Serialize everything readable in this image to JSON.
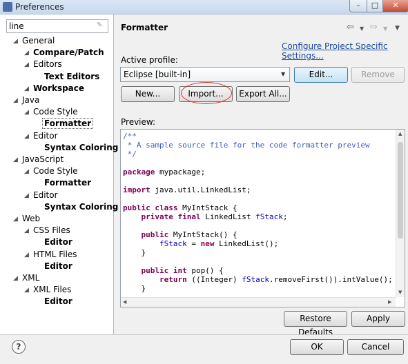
{
  "window": {
    "title": "Preferences",
    "min_glyph": "–",
    "max_glyph": "□",
    "close_glyph": "✕"
  },
  "filter": {
    "value": "line",
    "clear_icon": "eraser-icon"
  },
  "tree": [
    {
      "label": "General",
      "level": 0,
      "bold": false,
      "expanded": true
    },
    {
      "label": "Compare/Patch",
      "level": 1,
      "bold": true
    },
    {
      "label": "Editors",
      "level": 1,
      "bold": false,
      "expanded": true
    },
    {
      "label": "Text Editors",
      "level": 2,
      "bold": true
    },
    {
      "label": "Workspace",
      "level": 1,
      "bold": true
    },
    {
      "label": "Java",
      "level": 0,
      "bold": false,
      "expanded": true
    },
    {
      "label": "Code Style",
      "level": 1,
      "bold": false,
      "expanded": true
    },
    {
      "label": "Formatter",
      "level": 2,
      "bold": true,
      "selected": true
    },
    {
      "label": "Editor",
      "level": 1,
      "bold": false,
      "expanded": true
    },
    {
      "label": "Syntax Coloring",
      "level": 2,
      "bold": true
    },
    {
      "label": "JavaScript",
      "level": 0,
      "bold": false,
      "expanded": true
    },
    {
      "label": "Code Style",
      "level": 1,
      "bold": false,
      "expanded": true
    },
    {
      "label": "Formatter",
      "level": 2,
      "bold": true
    },
    {
      "label": "Editor",
      "level": 1,
      "bold": false,
      "expanded": true
    },
    {
      "label": "Syntax Coloring",
      "level": 2,
      "bold": true
    },
    {
      "label": "Web",
      "level": 0,
      "bold": false,
      "expanded": true
    },
    {
      "label": "CSS Files",
      "level": 1,
      "bold": false,
      "expanded": true
    },
    {
      "label": "Editor",
      "level": 2,
      "bold": true
    },
    {
      "label": "HTML Files",
      "level": 1,
      "bold": false,
      "expanded": true
    },
    {
      "label": "Editor",
      "level": 2,
      "bold": true
    },
    {
      "label": "XML",
      "level": 0,
      "bold": false,
      "expanded": true
    },
    {
      "label": "XML Files",
      "level": 1,
      "bold": false,
      "expanded": true
    },
    {
      "label": "Editor",
      "level": 2,
      "bold": true
    }
  ],
  "page": {
    "title": "Formatter",
    "configure_link": "Configure Project Specific Settings...",
    "active_profile_label": "Active profile:",
    "active_profile_value": "Eclipse [built-in]",
    "edit_label": "Edit...",
    "remove_label": "Remove",
    "new_label": "New...",
    "import_label": "Import...",
    "export_label": "Export All...",
    "preview_label": "Preview:",
    "restore_defaults_label": "Restore Defaults",
    "apply_label": "Apply",
    "ok_label": "OK",
    "cancel_label": "Cancel",
    "help_glyph": "?"
  },
  "preview_code": [
    [
      {
        "t": "/**",
        "c": "comment"
      }
    ],
    [
      {
        "t": " * A sample source file for the code formatter preview",
        "c": "comment"
      }
    ],
    [
      {
        "t": " */",
        "c": "comment"
      }
    ],
    [],
    [
      {
        "t": "package",
        "c": "kw"
      },
      {
        "t": " mypackage;"
      }
    ],
    [],
    [
      {
        "t": "import",
        "c": "kw"
      },
      {
        "t": " java.util.LinkedList;"
      }
    ],
    [],
    [
      {
        "t": "public",
        "c": "kw"
      },
      {
        "t": " "
      },
      {
        "t": "class",
        "c": "kw"
      },
      {
        "t": " MyIntStack {"
      }
    ],
    [
      {
        "t": "    "
      },
      {
        "t": "private",
        "c": "kw"
      },
      {
        "t": " "
      },
      {
        "t": "final",
        "c": "kw"
      },
      {
        "t": " LinkedList "
      },
      {
        "t": "fStack",
        "c": "fld"
      },
      {
        "t": ";"
      }
    ],
    [],
    [
      {
        "t": "    "
      },
      {
        "t": "public",
        "c": "kw"
      },
      {
        "t": " MyIntStack() {"
      }
    ],
    [
      {
        "t": "        "
      },
      {
        "t": "fStack",
        "c": "fld"
      },
      {
        "t": " = "
      },
      {
        "t": "new",
        "c": "kw"
      },
      {
        "t": " LinkedList();"
      }
    ],
    [
      {
        "t": "    }"
      }
    ],
    [],
    [
      {
        "t": "    "
      },
      {
        "t": "public",
        "c": "kw"
      },
      {
        "t": " "
      },
      {
        "t": "int",
        "c": "kw"
      },
      {
        "t": " pop() {"
      }
    ],
    [
      {
        "t": "        "
      },
      {
        "t": "return",
        "c": "kw"
      },
      {
        "t": " ((Integer) "
      },
      {
        "t": "fStack",
        "c": "fld"
      },
      {
        "t": ".removeFirst()).intValue();"
      }
    ],
    [
      {
        "t": "    }"
      }
    ]
  ],
  "colors": {
    "highlight_ring": "#d9312a",
    "link": "#1a4b9b",
    "comment": "#3f5fbf",
    "keyword": "#7f0055",
    "field": "#0000c0"
  }
}
